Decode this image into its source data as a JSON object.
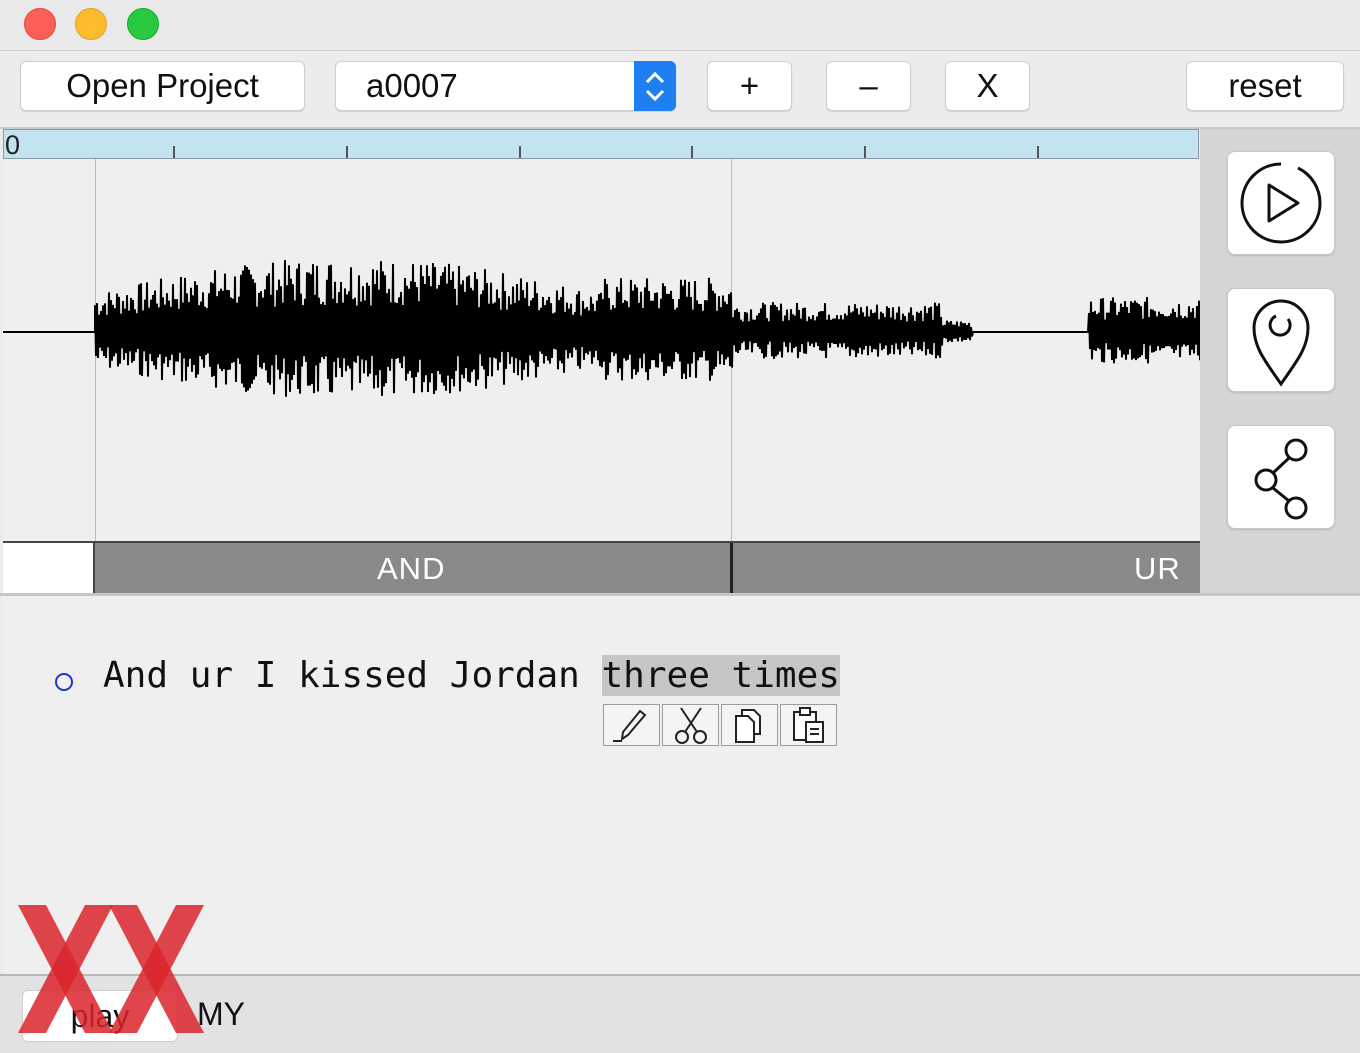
{
  "window": {
    "traffic_lights": [
      "close",
      "minimize",
      "zoom"
    ]
  },
  "toolbar": {
    "open_project_label": "Open Project",
    "recording_select_value": "a0007",
    "add_label": "+",
    "remove_label": "–",
    "close_label": "X",
    "reset_label": "reset"
  },
  "ruler": {
    "start_label": "0"
  },
  "segments": {
    "first_label": "AND",
    "second_label": "UR"
  },
  "side_tools": [
    "play-icon",
    "location-pin-icon",
    "share-icon"
  ],
  "transcript": {
    "text_before_selection": "And ur I kissed Jordan ",
    "selected_text": "three times"
  },
  "edit_toolbar": [
    "pencil-icon",
    "scissors-icon",
    "copy-icon",
    "paste-icon"
  ],
  "bottom": {
    "play_label": "play",
    "tier_label": "MY"
  },
  "colors": {
    "accent": "#1f7ff0",
    "ruler": "#c4e3f0",
    "segment_bar": "#8a8a8a",
    "selection": "#c6c6c6",
    "logo": "#d9242b"
  }
}
